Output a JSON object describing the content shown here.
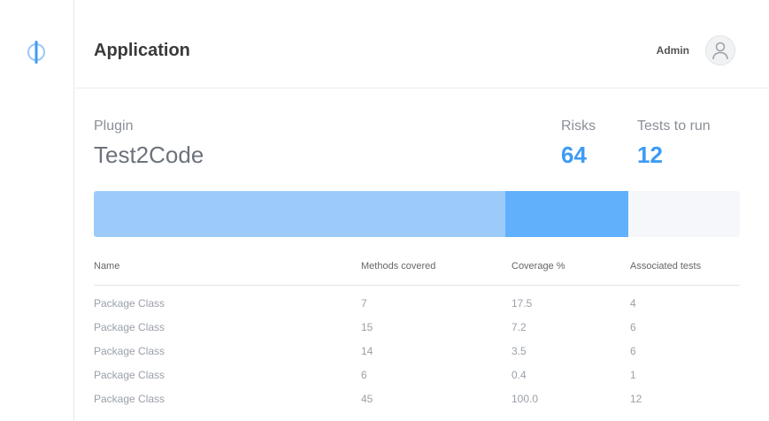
{
  "header": {
    "title": "Application",
    "user_name": "Admin"
  },
  "summary": {
    "plugin_label": "Plugin",
    "plugin_name": "Test2Code",
    "rules_label": "Risks",
    "rules_value": "64",
    "tests_label": "Tests to run",
    "tests_value": "12"
  },
  "coverage_bar": {
    "segment_a_fraction": 0.637,
    "segment_b_fraction": 0.19,
    "colors": {
      "segment_a": "#9ccbfa",
      "segment_b": "#61b0fb",
      "track": "#f5f7fa"
    }
  },
  "table": {
    "columns": [
      "Name",
      "Methods covered",
      "Coverage %",
      "Associated tests"
    ],
    "rows": [
      [
        "Package Class",
        "7",
        "17.5",
        "4"
      ],
      [
        "Package Class",
        "15",
        "7.2",
        "6"
      ],
      [
        "Package Class",
        "14",
        "3.5",
        "6"
      ],
      [
        "Package Class",
        "6",
        "0.4",
        "1"
      ],
      [
        "Package Class",
        "45",
        "100.0",
        "12"
      ]
    ]
  },
  "icons": {
    "logo": "plug-logo-icon",
    "avatar": "user-avatar-icon"
  },
  "colors": {
    "accent": "#3d9bf5"
  }
}
